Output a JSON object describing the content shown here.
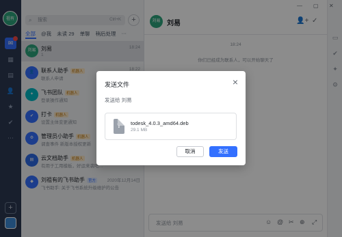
{
  "user": {
    "avatar_text": "祖有"
  },
  "rail": {
    "icons": [
      "chat-icon",
      "calendar-icon",
      "docs-icon",
      "contacts-icon",
      "star-icon",
      "check-icon",
      "more-icon"
    ]
  },
  "list": {
    "search_placeholder": "搜索",
    "search_shortcut": "Ctrl+K",
    "tabs": [
      "全部",
      "@我",
      "未读 29",
      "单聊",
      "稍后处理",
      "···"
    ],
    "chats": [
      {
        "avatar_text": "刘易",
        "avatar_color": "#2ca57c",
        "name": "刘易",
        "badge": "",
        "preview": "1",
        "time": "18:24"
      },
      {
        "avatar_text": "",
        "avatar_color": "#3370ff",
        "name": "联系人助手",
        "badge": "机器人",
        "preview": "联系人申请",
        "time": "18:22"
      },
      {
        "avatar_text": "",
        "avatar_color": "#00b9c4",
        "name": "飞书团队",
        "badge": "机器人",
        "preview": "登录操作通知",
        "time": ""
      },
      {
        "avatar_text": "",
        "avatar_color": "#3370ff",
        "name": "打卡",
        "badge": "机器人",
        "preview": "设置主体变更通知",
        "time": ""
      },
      {
        "avatar_text": "",
        "avatar_color": "#3370ff",
        "name": "管理员小助手",
        "badge": "机器人",
        "preview": "调查事件 新版本授权更新",
        "time": ""
      },
      {
        "avatar_text": "",
        "avatar_color": "#2c6ae6",
        "name": "云文档助手",
        "badge": "机器人",
        "preview": "有用于工用模板，好运来袭吧…",
        "time": ""
      },
      {
        "avatar_text": "",
        "avatar_color": "#3370ff",
        "name": "刘祖有的飞书助手",
        "badge": "官方",
        "preview": "飞书助手: 关于飞书系统升级维护的公告",
        "time": "2020年12月14日"
      }
    ]
  },
  "chat": {
    "avatar_text": "刘易",
    "title": "刘易",
    "time_label": "18:24",
    "system_message": "你们已经成为联系人，可以开始聊天了",
    "composer_placeholder": "发送给 刘易"
  },
  "modal": {
    "title": "发送文件",
    "send_to": "发送给 刘易",
    "file_name": "todesk_4.0.3_amd64.deb",
    "file_size": "29.1 MB",
    "file_icon_glyph": "?",
    "cancel_label": "取消",
    "send_label": "发送"
  },
  "colors": {
    "accent": "#3370ff",
    "rail_bg": "#2c3a52",
    "avatar_green": "#2ca57c"
  }
}
